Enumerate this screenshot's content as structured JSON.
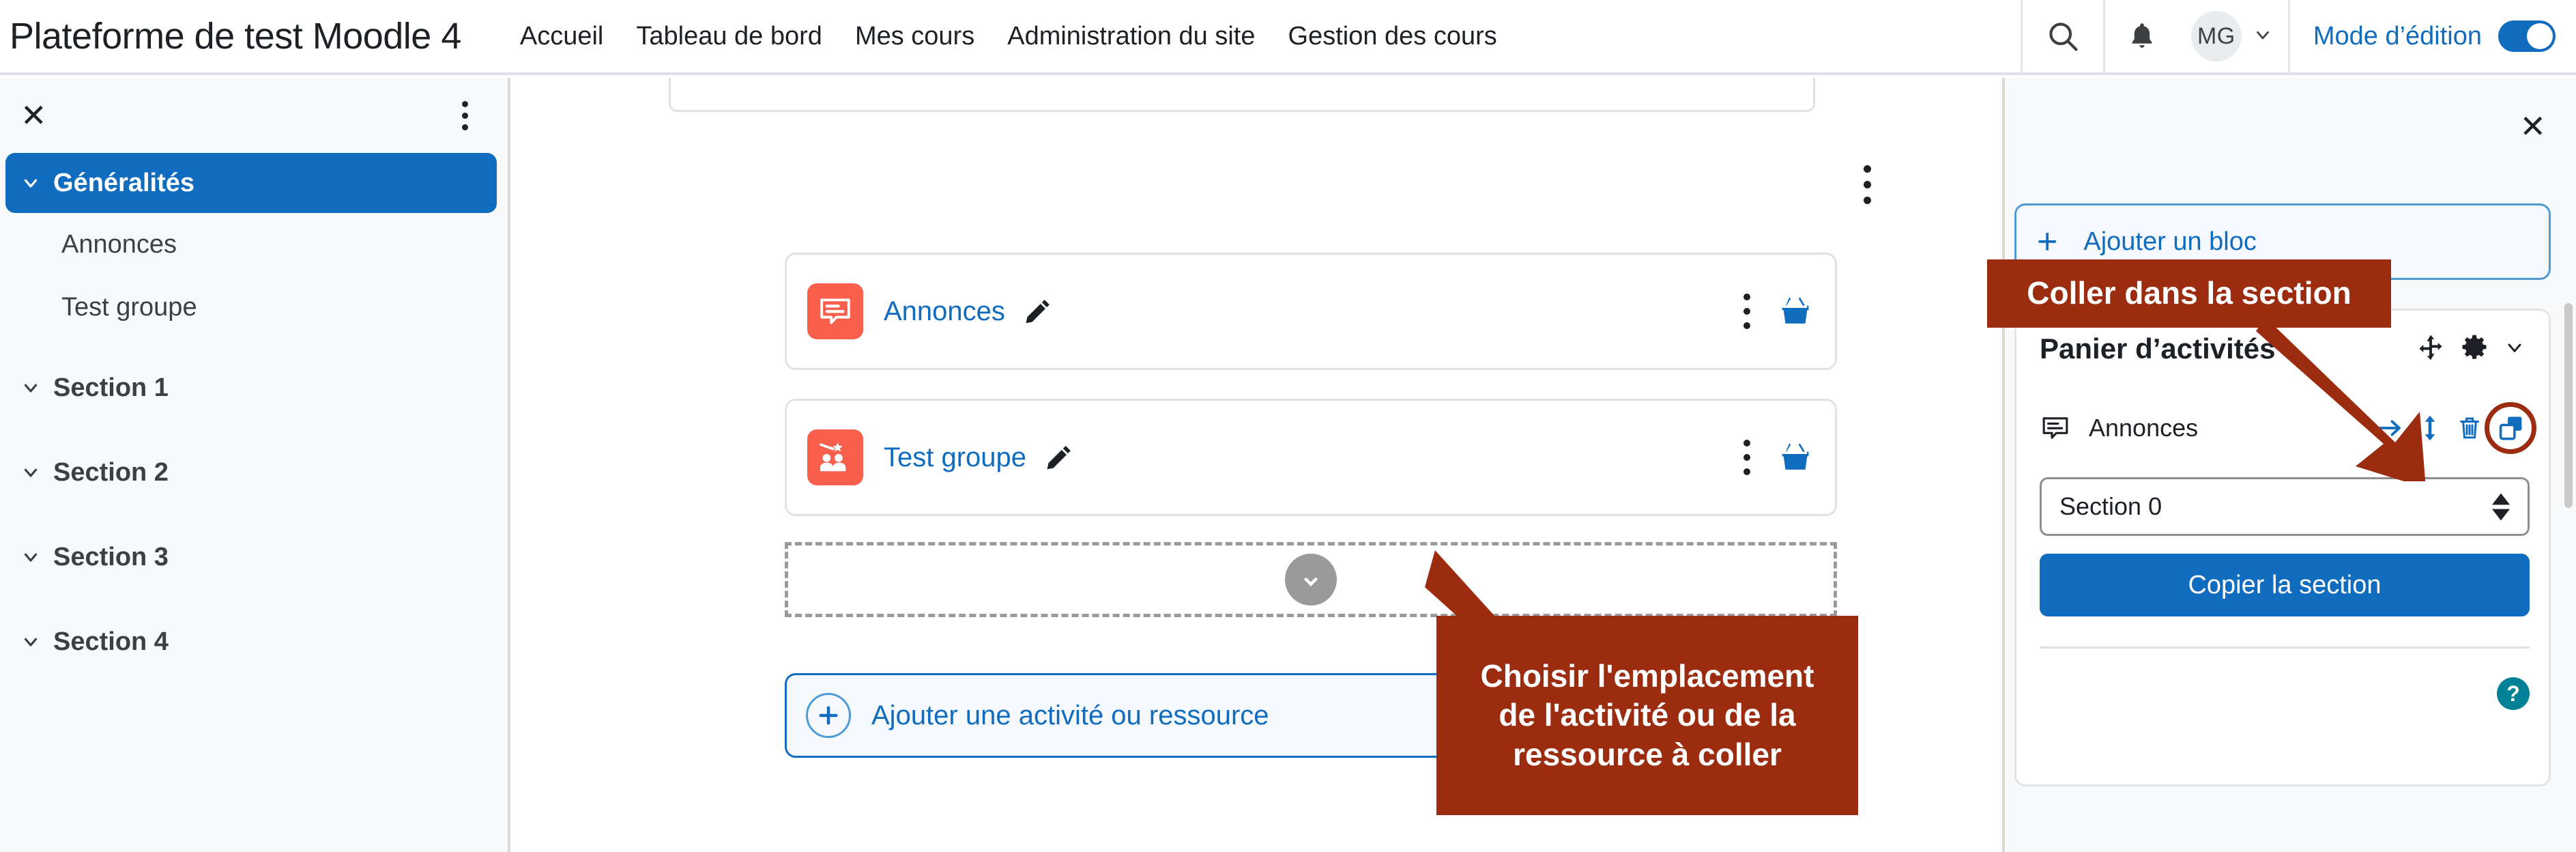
{
  "header": {
    "brand": "Plateforme de test Moodle 4",
    "nav": [
      {
        "label": "Accueil"
      },
      {
        "label": "Tableau de bord"
      },
      {
        "label": "Mes cours"
      },
      {
        "label": "Administration du site"
      },
      {
        "label": "Gestion des cours"
      }
    ],
    "search_icon": "search-icon",
    "notifications_icon": "bell-icon",
    "avatar_initials": "MG",
    "user_chevron": "chevron-down-icon",
    "edit_mode_label": "Mode d’édition",
    "edit_mode_on": true,
    "accent_color": "#0f6cbf"
  },
  "left_drawer": {
    "close_label": "✕",
    "menu_icon": "kebab-menu-icon",
    "items": [
      {
        "label": "Généralités",
        "active": true
      },
      {
        "label": "Section 1",
        "active": false
      },
      {
        "label": "Section 2",
        "active": false
      },
      {
        "label": "Section 3",
        "active": false
      },
      {
        "label": "Section 4",
        "active": false
      }
    ],
    "sub_items": [
      {
        "label": "Annonces"
      },
      {
        "label": "Test groupe"
      }
    ]
  },
  "main": {
    "section_menu_icon": "kebab-menu-icon",
    "activities": [
      {
        "name": "Annonces",
        "icon": "forum-icon",
        "icon_color": "#f8604d",
        "edit_icon": "pencil-icon",
        "menu_icon": "kebab-menu-icon",
        "basket_icon": "basket-icon"
      },
      {
        "name": "Test groupe",
        "icon": "group-choice-icon",
        "icon_color": "#f8604d",
        "edit_icon": "pencil-icon",
        "menu_icon": "kebab-menu-icon",
        "basket_icon": "basket-icon"
      }
    ],
    "dropzone": {
      "icon": "arrow-down-circle-icon"
    },
    "add_activity": {
      "icon": "plus-circle-icon",
      "label": "Ajouter une activité ou ressource"
    }
  },
  "right_drawer": {
    "close_label": "✕",
    "add_block": {
      "plus": "+",
      "label": "Ajouter un bloc"
    },
    "block": {
      "title": "Panier d’activités",
      "move_icon": "move-arrows-icon",
      "settings_icon": "gear-icon",
      "collapse_icon": "chevron-down-icon",
      "item": {
        "label": "Annonces",
        "icon": "forum-icon",
        "actions": [
          {
            "name": "move-right-icon"
          },
          {
            "name": "move-updown-icon"
          },
          {
            "name": "trash-icon"
          },
          {
            "name": "copy-icon"
          }
        ]
      },
      "section_select": {
        "value": "Section 0",
        "chevron": "updown-arrows-icon"
      },
      "copy_button": "Copier la section",
      "help_icon": "help-question-icon",
      "help_color": "#008196"
    }
  },
  "callouts": [
    {
      "text": "Coller dans la section",
      "color": "#9c2c10"
    },
    {
      "text": "Choisir l'emplacement de l'activité ou de la ressource à coller",
      "color": "#9c2c10"
    }
  ]
}
